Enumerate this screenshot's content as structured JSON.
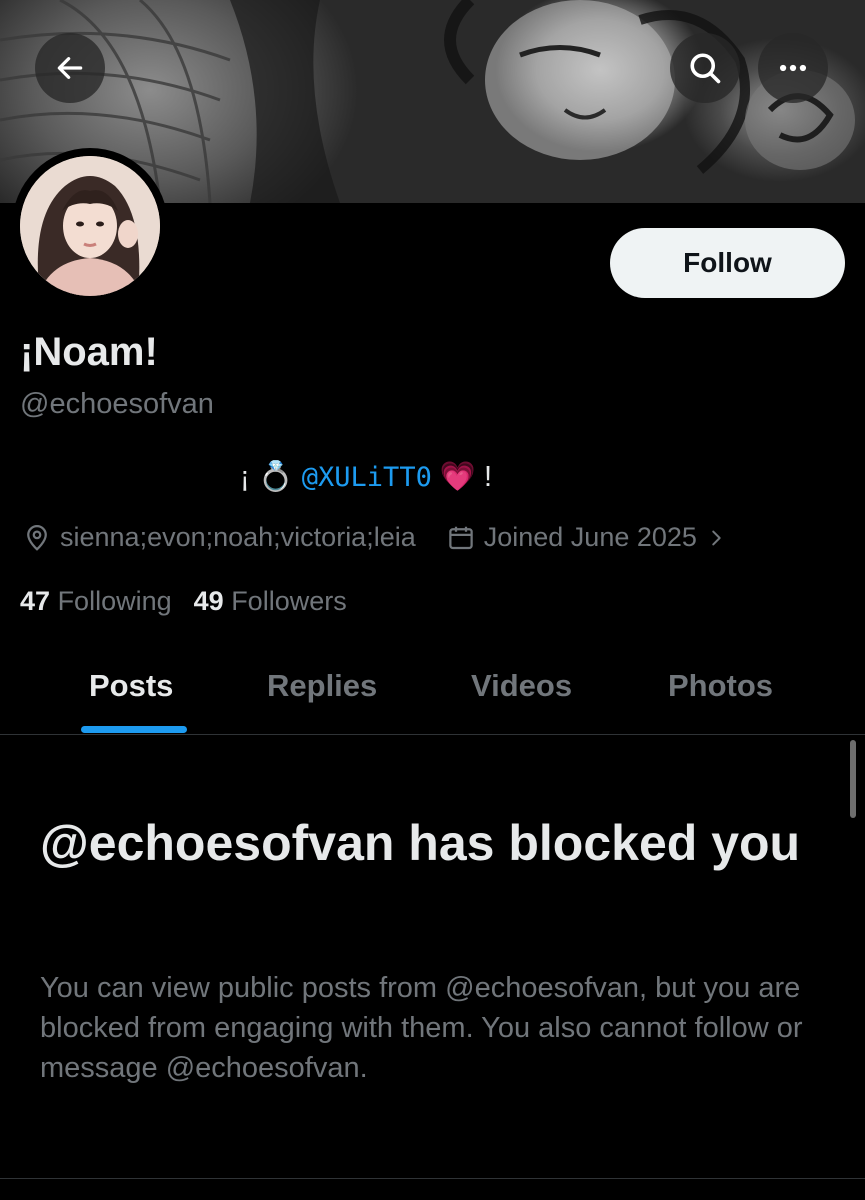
{
  "header": {
    "back_icon": "arrow-left-icon",
    "search_icon": "search-icon",
    "more_icon": "more-horizontal-icon"
  },
  "profile": {
    "display_name": "¡Noam!",
    "handle": "@echoesofvan",
    "follow_label": "Follow",
    "bio": {
      "prefix": "¡",
      "ring_emoji": "💍",
      "mention": "@XULiTT0",
      "heart_emoji": "💗",
      "suffix": "!"
    },
    "location": "sienna;evon;noah;victoria;leia",
    "joined": "Joined June 2025",
    "following_count": "47",
    "following_label": "Following",
    "followers_count": "49",
    "followers_label": "Followers"
  },
  "tabs": [
    {
      "label": "Posts",
      "active": true
    },
    {
      "label": "Replies",
      "active": false
    },
    {
      "label": "Videos",
      "active": false
    },
    {
      "label": "Photos",
      "active": false
    }
  ],
  "blocked": {
    "title": "@echoesofvan has blocked you",
    "message": "You can view public posts from @echoesofvan, but you are blocked from engaging with them. You also cannot follow or message @echoesofvan."
  },
  "colors": {
    "accent": "#1d9bf0",
    "background": "#000000",
    "primary_text": "#e7e9ea",
    "secondary_text": "#71767b",
    "follow_button_bg": "#eff3f4"
  }
}
